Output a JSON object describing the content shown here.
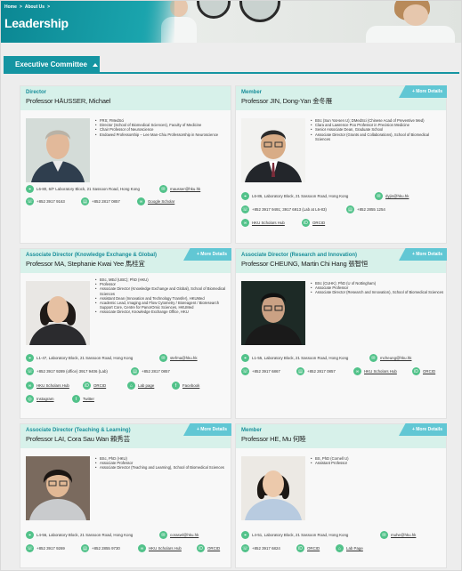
{
  "breadcrumb": [
    "Home",
    "About Us"
  ],
  "page_title": "Leadership",
  "section": {
    "label": "Executive Committee"
  },
  "more_label": "+ More Details",
  "colors": {
    "accent": "#1595a2",
    "header_bg": "#d7f1ea",
    "icon_green": "#52c28a",
    "more_tab": "#61c7d4"
  },
  "cards": [
    {
      "role": "Director",
      "name": "Professor HÄUSSER, Michael",
      "quals": [
        "FRS; FMedSci",
        "Director (School of Biomedical Sciences), Faculty of Medicine",
        "Chair Professor of Neuroscience",
        "Endowed Professorship – Lee Man-Chiu Professorship in Neuroscience"
      ],
      "address": "L6-80, 6/F Laboratory Block, 21 Sassoon Road, Hong Kong",
      "email": "mausser@hku.hk",
      "phone": "+852 3917 9163",
      "fax": "+852 2817 0857",
      "links": [
        "Google Scholar"
      ]
    },
    {
      "role": "Member",
      "name": "Professor JIN, Dong-Yan 金冬雁",
      "quals": [
        "BSc (Sun Yat-sen U); DMedSci (Chinese Acad of Preventive Med)",
        "Clara and Lawrence Poo Professor in Precision Medicine",
        "Senior Associate Dean, Graduate School",
        "Associate Director (Grants and Collaborations), School of Biomedical Sciences"
      ],
      "address": "L6-86, Laboratory Block, 21 Sassoon Road, Hong Kong",
      "email": "dyjin@hku.hk",
      "phone": "+852 3917 9491; 3917 6913 (Lab at L6-83)",
      "fax": "+852 2855 1254",
      "links": [
        "HKU Scholars Hub",
        "ORCID"
      ]
    },
    {
      "role": "Associate Director (Knowledge Exchange & Global)",
      "name": "Professor MA, Stephanie Kwai Yee 馬桂宜",
      "quals": [
        "BSc, MEd (UBC); PhD (HKU)",
        "Professor",
        "Associate Director (Knowledge Exchange and Global), School of Biomedical Sciences",
        "Assistant Dean (Innovation and Technology Transfer), HKUMed",
        "Academic Lead, Imaging and Flow Cytometry / Bioreagent / Bioresearch Support Core, Centre for PanorOmic Sciences, HKUMed",
        "Associate Director, Knowledge Exchange Office, HKU"
      ],
      "address": "L1-47, Laboratory Block, 21 Sassoon Road, Hong Kong",
      "email": "stefma@hku.hk",
      "phone": "+852 3917 9289 (office) 3917 9406 (Lab)",
      "fax": "+852 2817 0857",
      "links": [
        "HKU Scholars Hub",
        "ORCID",
        "Lab page",
        "Facebook",
        "Instagram",
        "Twitter"
      ]
    },
    {
      "role": "Associate Director (Research and Innovation)",
      "name": "Professor CHEUNG, Martin Chi Hang 張智恒",
      "quals": [
        "BSc (CUHK); PhD (U of Nottingham)",
        "Associate Professor",
        "Associate Director (Research and Innovation), School of Biomedical Sciences"
      ],
      "address": "L1-55, Laboratory Block, 21 Sassoon Road, Hong Kong",
      "email": "mcheung@hku.hk",
      "phone": "+852 3917 6867",
      "fax": "+852 2817 0857",
      "links": [
        "HKU Scholars Hub",
        "ORCID"
      ]
    },
    {
      "role": "Associate Director (Teaching & Learning)",
      "name": "Professor LAI, Cora Sau Wan 賴秀芸",
      "quals": [
        "BSc, PhD (HKU)",
        "Associate Professor",
        "Associate Director (Teaching and Learning), School of Biomedical Sciences"
      ],
      "address": "L4-56, Laboratory Block, 21 Sassoon Road, Hong Kong",
      "email": "coraswl@hku.hk",
      "phone": "+852 3917 9269",
      "fax": "+852 2855 9730",
      "links": [
        "HKU Scholars Hub",
        "ORCID"
      ]
    },
    {
      "role": "Member",
      "name": "Professor HE, Mu 何睦",
      "quals": [
        "BS, PhD (Cornell U)",
        "Assistant Professor"
      ],
      "address": "L4-51, Laboratory Block, 21 Sassoon Road, Hong Kong",
      "email": "muhe@hku.hk",
      "phone": "+852 3917 6824",
      "links": [
        "ORCID",
        "Lab Page"
      ]
    }
  ]
}
